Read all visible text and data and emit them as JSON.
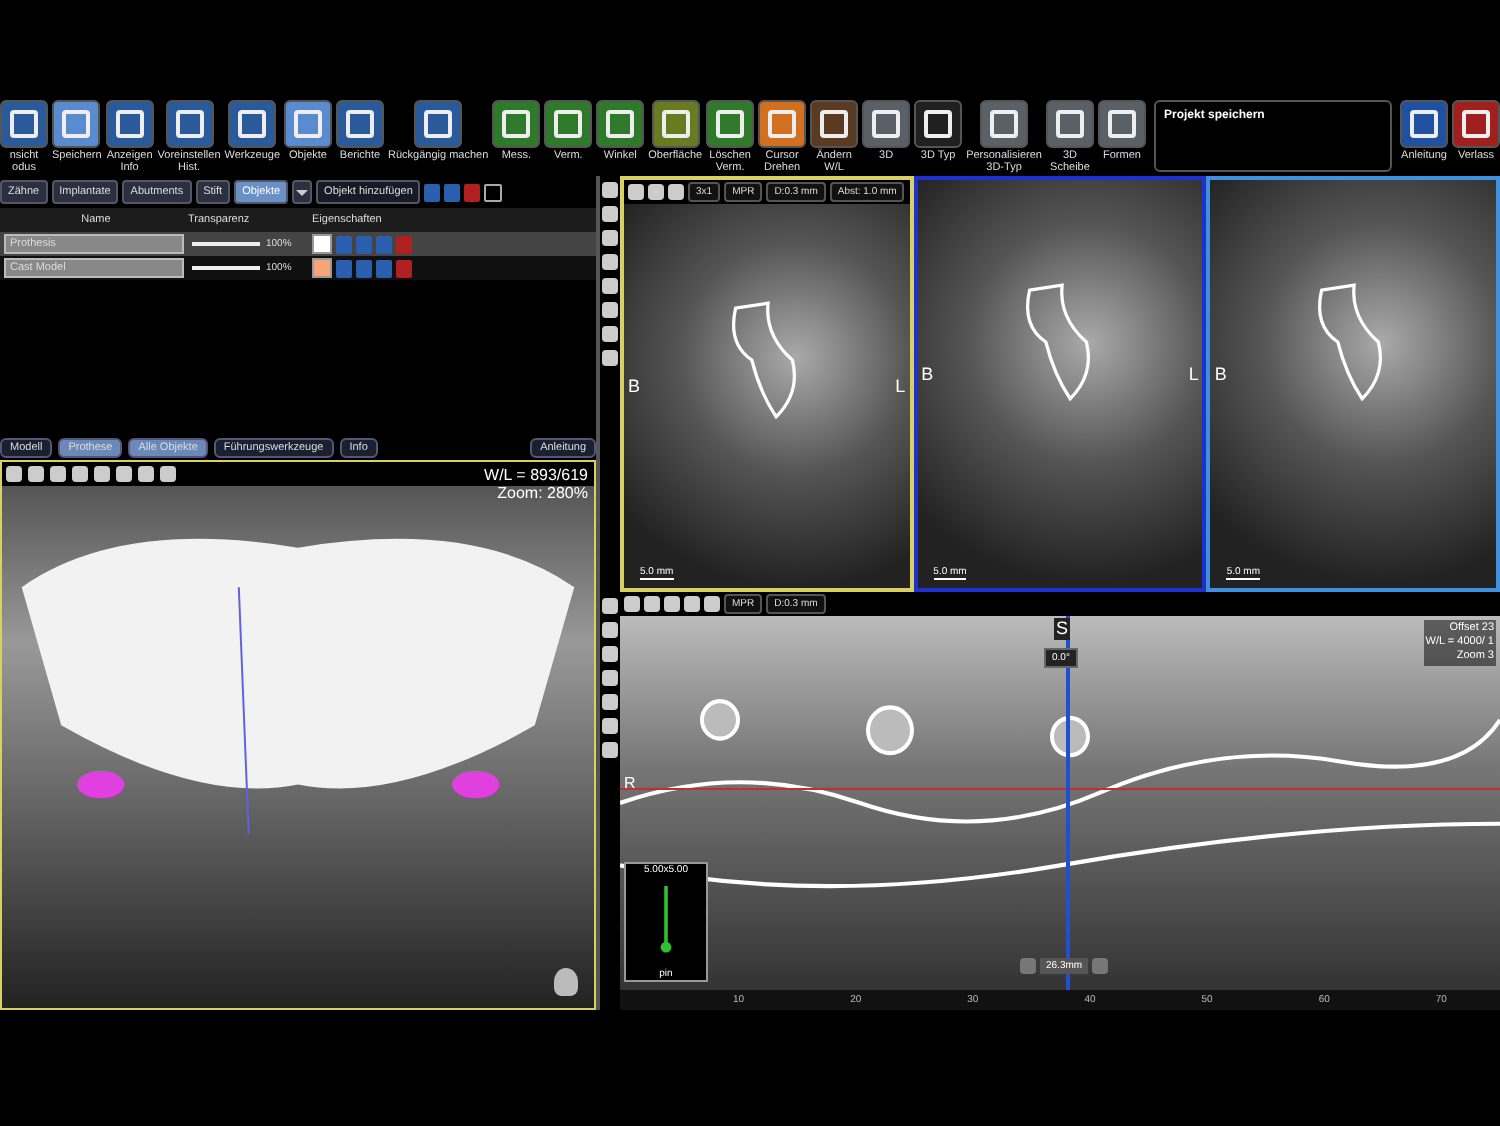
{
  "toolbar": {
    "tools": [
      {
        "label": "nsicht\nodus",
        "kind": "blue"
      },
      {
        "label": "Speichern",
        "kind": "light"
      },
      {
        "label": "Anzeigen\nInfo",
        "kind": "blue"
      },
      {
        "label": "Voreinstellen\nHist.",
        "kind": "blue"
      },
      {
        "label": "Werkzeuge",
        "kind": "blue"
      },
      {
        "label": "Objekte",
        "kind": "light"
      },
      {
        "label": "Berichte",
        "kind": "blue"
      },
      {
        "label": "Rückgängig machen",
        "kind": "blue"
      },
      {
        "label": "Mess.",
        "kind": "green"
      },
      {
        "label": "Verm.",
        "kind": "green"
      },
      {
        "label": "Winkel",
        "kind": "green"
      },
      {
        "label": "Oberfläche",
        "kind": "olive"
      },
      {
        "label": "Löschen\nVerm.",
        "kind": "green"
      },
      {
        "label": "Cursor\nDrehen",
        "kind": "orange"
      },
      {
        "label": "Ändern\nW/L",
        "kind": "brown"
      },
      {
        "label": "3D",
        "kind": "grey"
      },
      {
        "label": "3D Typ",
        "kind": "dark"
      },
      {
        "label": "Personalisieren\n3D-Typ",
        "kind": "grey"
      },
      {
        "label": "3D\nScheibe",
        "kind": "grey"
      },
      {
        "label": "Formen",
        "kind": "grey"
      }
    ],
    "message": "Projekt speichern",
    "end_tools": [
      {
        "label": "Anleitung",
        "kind": "help"
      },
      {
        "label": "Verlass",
        "kind": "exit"
      }
    ]
  },
  "objects_panel": {
    "tabs": [
      {
        "label": "Zähne",
        "selected": false
      },
      {
        "label": "Implantate",
        "selected": false
      },
      {
        "label": "Abutments",
        "selected": false
      },
      {
        "label": "Stift",
        "selected": false
      },
      {
        "label": "Objekte",
        "selected": true
      }
    ],
    "add_button": "Objekt hinzufügen",
    "columns": [
      "Name",
      "Transparenz",
      "Eigenschaften"
    ],
    "rows": [
      {
        "name": "Prothesis",
        "level": 1.0,
        "reading": "100%",
        "color": "#ffffff",
        "selected": true
      },
      {
        "name": "Cast Model",
        "level": 1.0,
        "reading": "100%",
        "color": "#f4a57a",
        "selected": false
      }
    ]
  },
  "view_tabs": [
    {
      "label": "Modell",
      "selected": false
    },
    {
      "label": "Prothese",
      "selected": true
    },
    {
      "label": "Alle Objekte",
      "selected": true
    },
    {
      "label": "Führungswerkzeuge",
      "selected": false
    },
    {
      "label": "Info",
      "selected": false
    }
  ],
  "view_help": "Anleitung",
  "view_3d": {
    "wl": "W/L = 893/619",
    "zoom": "Zoom: 280%"
  },
  "cross_sections": {
    "buttons": [
      "3x1",
      "MPR",
      "D:0.3 mm",
      "Abst: 1.0 mm"
    ],
    "views": [
      {
        "left_label": "B",
        "right_label": "L",
        "scale": "5.0 mm",
        "color": "#d8d060"
      },
      {
        "left_label": "B",
        "right_label": "L",
        "scale": "5.0 mm",
        "color": "#2030d0"
      },
      {
        "left_label": "B",
        "scale": "5.0 mm",
        "color": "#4090e0"
      }
    ]
  },
  "panoramic": {
    "buttons": [
      "MPR",
      "D:0.3 mm"
    ],
    "top_label": "S",
    "angle": "0.0°",
    "side_label": "R",
    "info": [
      "Offset 23",
      "W/L = 4000/ 1",
      "Zoom 3"
    ],
    "inset": "5.00x5.00",
    "implant_label": "pin",
    "position": "26.3mm",
    "ruler": [
      "10",
      "20",
      "30",
      "40",
      "50",
      "60",
      "70"
    ]
  }
}
